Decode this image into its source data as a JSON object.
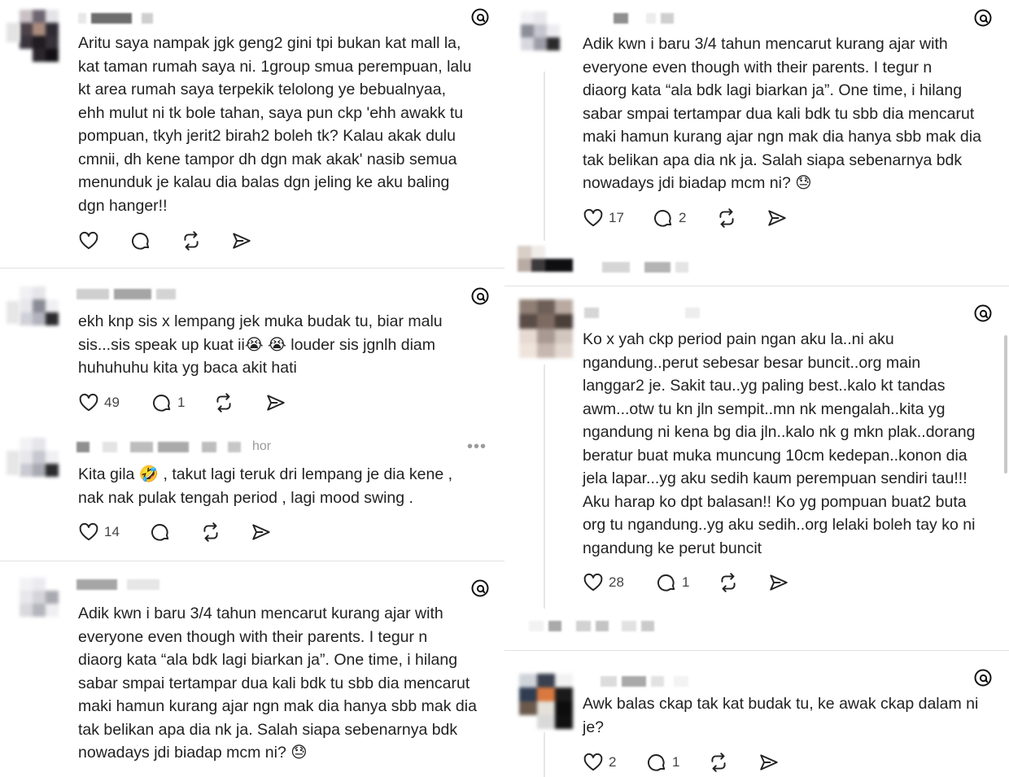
{
  "left": {
    "posts": [
      {
        "body": "Aritu saya nampak jgk geng2 gini tpi bukan kat mall la,\nkat taman rumah saya ni. 1group smua perempuan, lalu\nkt area rumah saya terpekik telolong ye bebualnyaa,\nehh mulut ni tk bole tahan, saya pun ckp 'ehh awakk tu\npompuan, tkyh jerit2 birah2 boleh tk? Kalau akak dulu\ncmnii, dh kene tampor dh dgn mak akak' nasib semua\nmenunduk je kalau dia balas dgn jeling ke aku baling\ndgn hanger!!",
        "likes": "",
        "replies": ""
      },
      {
        "body": "ekh knp sis x lempang jek muka budak tu, biar malu\nsis...sis speak up kuat ii😭 😭 louder sis jgnlh diam\nhuhuhuhu kita yg baca akit hati",
        "likes": "49",
        "replies": "1"
      },
      {
        "handle_suffix": "hor",
        "more": "•••",
        "body": "Kita gila 🤣 , takut lagi teruk dri lempang je dia kene ,\nnak nak pulak tengah period , lagi mood swing .",
        "likes": "14",
        "replies": ""
      },
      {
        "body": "Adik kwn i baru 3/4 tahun mencarut kurang ajar with\neveryone even though with their parents. I tegur n\ndiaorg kata “ala bdk lagi biarkan ja”. One time, i hilang\nsabar smpai tertampar dua kali bdk tu sbb dia mencarut\nmaki hamun kurang ajar ngn mak dia hanya sbb mak dia\ntak belikan apa dia nk ja. Salah siapa sebenarnya bdk\nnowadays jdi biadap mcm ni? 😓",
        "likes": "",
        "replies": ""
      }
    ]
  },
  "right": {
    "posts": [
      {
        "body": "Adik kwn i baru 3/4 tahun mencarut kurang ajar with\neveryone even though with their parents. I tegur n\ndiaorg kata “ala bdk lagi biarkan ja”. One time, i hilang\nsabar smpai tertampar dua kali bdk tu sbb dia mencarut\nmaki hamun kurang ajar ngn mak dia hanya sbb mak dia\ntak belikan apa dia nk ja. Salah siapa sebenarnya bdk\nnowadays jdi biadap mcm ni? 😓",
        "likes": "17",
        "replies": "2"
      },
      {
        "body": "Ko x yah ckp period pain ngan aku la..ni aku\nngandung..perut sebesar besar buncit..org main\nlanggar2 je. Sakit tau..yg paling best..kalo kt tandas\nawm...otw tu kn jln sempit..mn nk mengalah..kita yg\nngandung ni kena bg dia jln..kalo nk g mkn plak..dorang\nberatur buat muka muncung 10cm kedepan..konon dia\njela lapar...yg aku sedih kaum perempuan sendiri tau!!!\nAku harap ko dpt balasan!! Ko yg pompuan buat2 buta\norg tu ngandung..yg aku sedih..org lelaki boleh tay ko ni\nngandung ke perut buncit",
        "likes": "28",
        "replies": "1"
      },
      {
        "body": "Awk balas ckap tak kat budak tu, ke awak ckap dalam ni\nje?",
        "likes": "2",
        "replies": "1"
      }
    ]
  },
  "icons": {
    "like": "heart-icon",
    "reply": "comment-icon",
    "repost": "repost-icon",
    "share": "share-icon",
    "platform": "threads-logo-icon"
  },
  "colors": {
    "text": "#222222",
    "muted": "#9a9a9a",
    "divider": "#e2e2e2"
  }
}
